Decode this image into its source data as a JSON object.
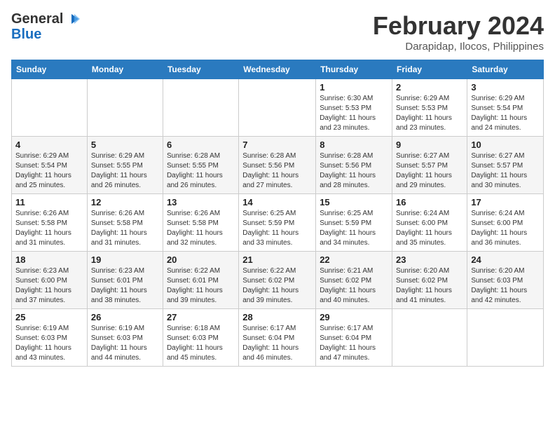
{
  "header": {
    "logo_line1": "General",
    "logo_line2": "Blue",
    "month_title": "February 2024",
    "subtitle": "Darapidap, Ilocos, Philippines"
  },
  "days_of_week": [
    "Sunday",
    "Monday",
    "Tuesday",
    "Wednesday",
    "Thursday",
    "Friday",
    "Saturday"
  ],
  "weeks": [
    [
      {
        "day": "",
        "info": ""
      },
      {
        "day": "",
        "info": ""
      },
      {
        "day": "",
        "info": ""
      },
      {
        "day": "",
        "info": ""
      },
      {
        "day": "1",
        "info": "Sunrise: 6:30 AM\nSunset: 5:53 PM\nDaylight: 11 hours\nand 23 minutes."
      },
      {
        "day": "2",
        "info": "Sunrise: 6:29 AM\nSunset: 5:53 PM\nDaylight: 11 hours\nand 23 minutes."
      },
      {
        "day": "3",
        "info": "Sunrise: 6:29 AM\nSunset: 5:54 PM\nDaylight: 11 hours\nand 24 minutes."
      }
    ],
    [
      {
        "day": "4",
        "info": "Sunrise: 6:29 AM\nSunset: 5:54 PM\nDaylight: 11 hours\nand 25 minutes."
      },
      {
        "day": "5",
        "info": "Sunrise: 6:29 AM\nSunset: 5:55 PM\nDaylight: 11 hours\nand 26 minutes."
      },
      {
        "day": "6",
        "info": "Sunrise: 6:28 AM\nSunset: 5:55 PM\nDaylight: 11 hours\nand 26 minutes."
      },
      {
        "day": "7",
        "info": "Sunrise: 6:28 AM\nSunset: 5:56 PM\nDaylight: 11 hours\nand 27 minutes."
      },
      {
        "day": "8",
        "info": "Sunrise: 6:28 AM\nSunset: 5:56 PM\nDaylight: 11 hours\nand 28 minutes."
      },
      {
        "day": "9",
        "info": "Sunrise: 6:27 AM\nSunset: 5:57 PM\nDaylight: 11 hours\nand 29 minutes."
      },
      {
        "day": "10",
        "info": "Sunrise: 6:27 AM\nSunset: 5:57 PM\nDaylight: 11 hours\nand 30 minutes."
      }
    ],
    [
      {
        "day": "11",
        "info": "Sunrise: 6:26 AM\nSunset: 5:58 PM\nDaylight: 11 hours\nand 31 minutes."
      },
      {
        "day": "12",
        "info": "Sunrise: 6:26 AM\nSunset: 5:58 PM\nDaylight: 11 hours\nand 31 minutes."
      },
      {
        "day": "13",
        "info": "Sunrise: 6:26 AM\nSunset: 5:58 PM\nDaylight: 11 hours\nand 32 minutes."
      },
      {
        "day": "14",
        "info": "Sunrise: 6:25 AM\nSunset: 5:59 PM\nDaylight: 11 hours\nand 33 minutes."
      },
      {
        "day": "15",
        "info": "Sunrise: 6:25 AM\nSunset: 5:59 PM\nDaylight: 11 hours\nand 34 minutes."
      },
      {
        "day": "16",
        "info": "Sunrise: 6:24 AM\nSunset: 6:00 PM\nDaylight: 11 hours\nand 35 minutes."
      },
      {
        "day": "17",
        "info": "Sunrise: 6:24 AM\nSunset: 6:00 PM\nDaylight: 11 hours\nand 36 minutes."
      }
    ],
    [
      {
        "day": "18",
        "info": "Sunrise: 6:23 AM\nSunset: 6:00 PM\nDaylight: 11 hours\nand 37 minutes."
      },
      {
        "day": "19",
        "info": "Sunrise: 6:23 AM\nSunset: 6:01 PM\nDaylight: 11 hours\nand 38 minutes."
      },
      {
        "day": "20",
        "info": "Sunrise: 6:22 AM\nSunset: 6:01 PM\nDaylight: 11 hours\nand 39 minutes."
      },
      {
        "day": "21",
        "info": "Sunrise: 6:22 AM\nSunset: 6:02 PM\nDaylight: 11 hours\nand 39 minutes."
      },
      {
        "day": "22",
        "info": "Sunrise: 6:21 AM\nSunset: 6:02 PM\nDaylight: 11 hours\nand 40 minutes."
      },
      {
        "day": "23",
        "info": "Sunrise: 6:20 AM\nSunset: 6:02 PM\nDaylight: 11 hours\nand 41 minutes."
      },
      {
        "day": "24",
        "info": "Sunrise: 6:20 AM\nSunset: 6:03 PM\nDaylight: 11 hours\nand 42 minutes."
      }
    ],
    [
      {
        "day": "25",
        "info": "Sunrise: 6:19 AM\nSunset: 6:03 PM\nDaylight: 11 hours\nand 43 minutes."
      },
      {
        "day": "26",
        "info": "Sunrise: 6:19 AM\nSunset: 6:03 PM\nDaylight: 11 hours\nand 44 minutes."
      },
      {
        "day": "27",
        "info": "Sunrise: 6:18 AM\nSunset: 6:03 PM\nDaylight: 11 hours\nand 45 minutes."
      },
      {
        "day": "28",
        "info": "Sunrise: 6:17 AM\nSunset: 6:04 PM\nDaylight: 11 hours\nand 46 minutes."
      },
      {
        "day": "29",
        "info": "Sunrise: 6:17 AM\nSunset: 6:04 PM\nDaylight: 11 hours\nand 47 minutes."
      },
      {
        "day": "",
        "info": ""
      },
      {
        "day": "",
        "info": ""
      }
    ]
  ]
}
